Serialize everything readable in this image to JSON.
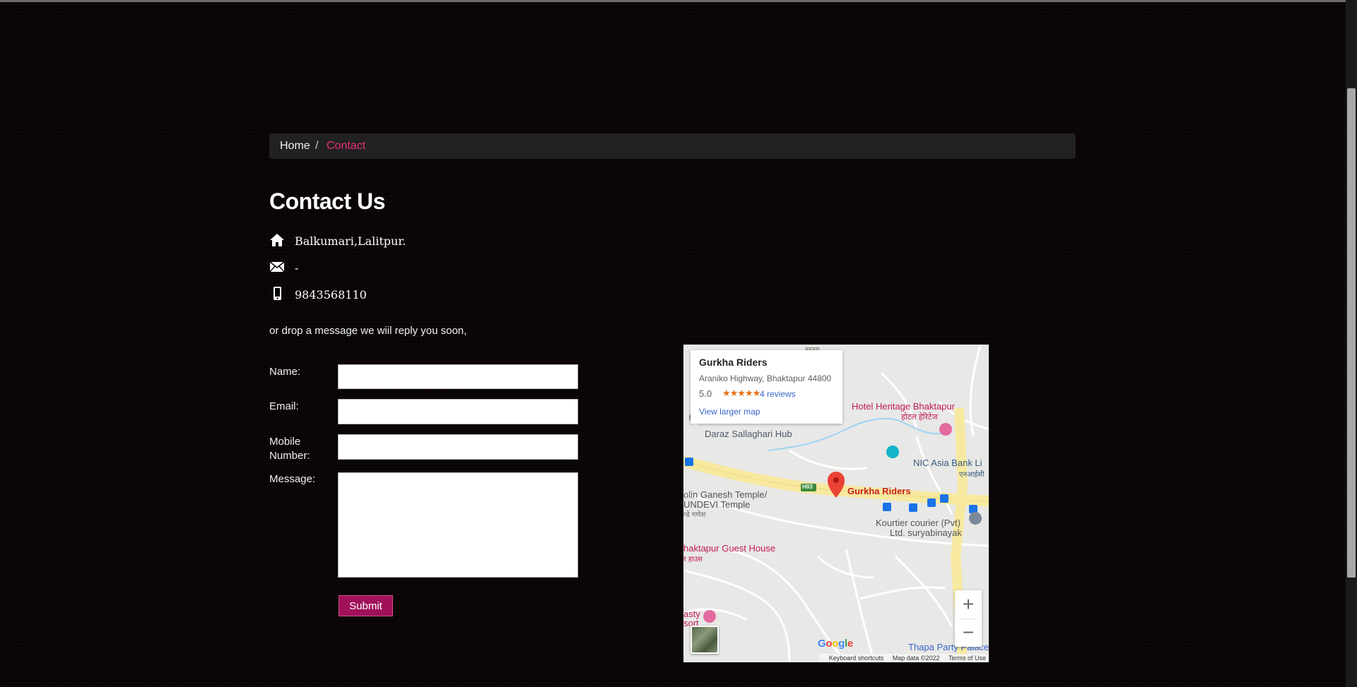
{
  "breadcrumb": {
    "home": "Home",
    "separator": "/",
    "current": "Contact"
  },
  "heading": "Contact Us",
  "contact": {
    "address": "Balkumari,Lalitpur.",
    "email": "-",
    "phone": "9843568110"
  },
  "drop_message": "or drop a message we wiil reply you soon,",
  "form": {
    "name_label": "Name:",
    "email_label": "Email:",
    "mobile_label": "Mobile Number:",
    "message_label": "Message:",
    "name_value": "",
    "email_value": "",
    "mobile_value": "",
    "message_value": "",
    "submit_label": "Submit"
  },
  "map": {
    "card": {
      "title": "Gurkha Riders",
      "address": "Araniko Highway, Bhaktapur 44800",
      "rating": "5.0",
      "stars": "★★★★★",
      "reviews": "4 reviews",
      "larger_map": "View larger map"
    },
    "labels": {
      "hotel_heritage": "Hotel Heritage Bhaktapur",
      "hotel_heritage_local": "होटल हेरिटेज",
      "daraz": "Daraz Sallaghari Hub",
      "nic_asia": "NIC Asia Bank Li",
      "nic_asia_local": "एनआईसी",
      "gurkha_riders": "Gurkha Riders",
      "ganesh_temple": "olin Ganesh Temple/",
      "sundevi": "UNDEVI Temple",
      "ganesh_local": "न्डे गणेश",
      "courier_1": "Kourtier courier (Pvt)",
      "courier_2": "Ltd. suryabinayak",
      "guest_house": "haktapur Guest House",
      "guest_house_local": "र हाउस",
      "resort_1": "asty",
      "resort_2": "sort",
      "thapa": "Thapa Party Palace",
      "highway": "H03",
      "top_local": "बहुरुप"
    },
    "zoom_in": "+",
    "zoom_out": "−",
    "google": "Google",
    "footer": {
      "shortcuts": "Keyboard shortcuts",
      "data": "Map data ©2022",
      "terms": "Terms of Use"
    },
    "colors": {
      "pin": "#ea4335",
      "poi_pink": "#c2185b",
      "poi_blue": "#1a73e8",
      "road": "#f7e9a0"
    }
  }
}
